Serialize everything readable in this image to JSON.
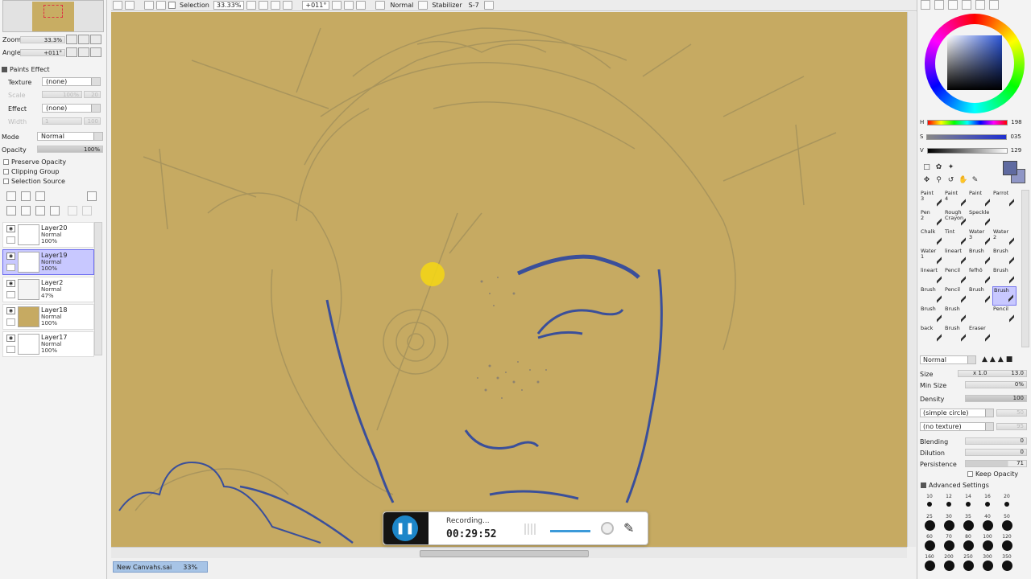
{
  "toolbar": {
    "selection_label": "Selection",
    "zoom": "33.33%",
    "angle": "+011°",
    "blend_mode": "Normal",
    "stabilizer_label": "Stabilizer",
    "stabilizer_value": "S-7"
  },
  "navigator": {
    "zoom_label": "Zoom",
    "zoom_value": "33.3%",
    "angle_label": "Angle",
    "angle_value": "+011°"
  },
  "paints_effect": {
    "title": "Paints Effect",
    "texture_label": "Texture",
    "texture_value": "(none)",
    "effect_label": "Effect",
    "effect_value": "(none)",
    "scale_label": "Scale",
    "scale_value": "100%",
    "scale_num": "20",
    "width_label": "Width",
    "width_value": "1",
    "width_num": "100"
  },
  "layer_props": {
    "mode_label": "Mode",
    "mode_value": "Normal",
    "opacity_label": "Opacity",
    "opacity_value": "100%",
    "preserve_opacity": "Preserve Opacity",
    "clipping_group": "Clipping Group",
    "selection_source": "Selection Source"
  },
  "layers": [
    {
      "name": "Layer20",
      "mode": "Normal",
      "opacity": "100%",
      "selected": false,
      "thumb": "#ffffff"
    },
    {
      "name": "Layer19",
      "mode": "Normal",
      "opacity": "100%",
      "selected": true,
      "thumb": "#ffffff"
    },
    {
      "name": "Layer2",
      "mode": "Normal",
      "opacity": "47%",
      "selected": false,
      "thumb": "#f4f4f4"
    },
    {
      "name": "Layer18",
      "mode": "Normal",
      "opacity": "100%",
      "selected": false,
      "thumb": "#c6aa62"
    },
    {
      "name": "Layer17",
      "mode": "Normal",
      "opacity": "100%",
      "selected": false,
      "thumb": "#ffffff"
    }
  ],
  "recording": {
    "status": "Recording...",
    "time": "00:29:52"
  },
  "canvas_tab": {
    "name": "New Canvahs.sai",
    "zoom": "33%"
  },
  "color": {
    "h_label": "H",
    "h_value": "198",
    "s_label": "S",
    "s_value": "035",
    "v_label": "V",
    "v_value": "129",
    "primary": "#5f6aa0",
    "canvas": "#c6aa62",
    "line": "#3a4f9a"
  },
  "brushes": [
    {
      "top": "Paint",
      "bot": "3"
    },
    {
      "top": "Paint",
      "bot": "4"
    },
    {
      "top": "Paint",
      "bot": ""
    },
    {
      "top": "Parrot",
      "bot": ""
    },
    {
      "top": "Pen",
      "bot": "2"
    },
    {
      "top": "Rough",
      "bot": "Crayon"
    },
    {
      "top": "Speckle",
      "bot": ""
    },
    {
      "top": "",
      "bot": ""
    },
    {
      "top": "Chalk",
      "bot": ""
    },
    {
      "top": "Tint",
      "bot": ""
    },
    {
      "top": "Water",
      "bot": "3"
    },
    {
      "top": "Water",
      "bot": "2"
    },
    {
      "top": "Water",
      "bot": "1"
    },
    {
      "top": "lineart",
      "bot": ""
    },
    {
      "top": "Brush",
      "bot": ""
    },
    {
      "top": "Brush",
      "bot": ""
    },
    {
      "top": "lineart",
      "bot": ""
    },
    {
      "top": "Pencil",
      "bot": ""
    },
    {
      "top": "fefhô",
      "bot": ""
    },
    {
      "top": "Brush",
      "bot": ""
    },
    {
      "top": "Brush",
      "bot": ""
    },
    {
      "top": "Pencil",
      "bot": ""
    },
    {
      "top": "Brush",
      "bot": ""
    },
    {
      "top": "Brush",
      "bot": "",
      "sel": true
    },
    {
      "top": "Brush",
      "bot": ""
    },
    {
      "top": "Brush",
      "bot": ""
    },
    {
      "top": "",
      "bot": ""
    },
    {
      "top": "Pencil",
      "bot": ""
    },
    {
      "top": "back",
      "bot": ""
    },
    {
      "top": "Brush",
      "bot": ""
    },
    {
      "top": "Eraser",
      "bot": ""
    },
    {
      "top": "",
      "bot": ""
    }
  ],
  "brush_props": {
    "mode": "Normal",
    "size_label": "Size",
    "size_mult": "x 1.0",
    "size_value": "13.0",
    "min_size_label": "Min Size",
    "min_size_value": "0%",
    "density_label": "Density",
    "density_value": "100",
    "shape": "(simple circle)",
    "shape_num": "50",
    "texture": "(no texture)",
    "texture_num": "95",
    "blending_label": "Blending",
    "blending_value": "0",
    "dilution_label": "Dilution",
    "dilution_value": "0",
    "persistence_label": "Persistence",
    "persistence_value": "71",
    "keep_opacity": "Keep Opacity",
    "advanced": "Advanced Settings"
  },
  "brush_sizes": [
    "10",
    "12",
    "14",
    "16",
    "20",
    "25",
    "30",
    "35",
    "40",
    "50",
    "60",
    "70",
    "80",
    "100",
    "120",
    "160",
    "200",
    "250",
    "300",
    "350"
  ]
}
